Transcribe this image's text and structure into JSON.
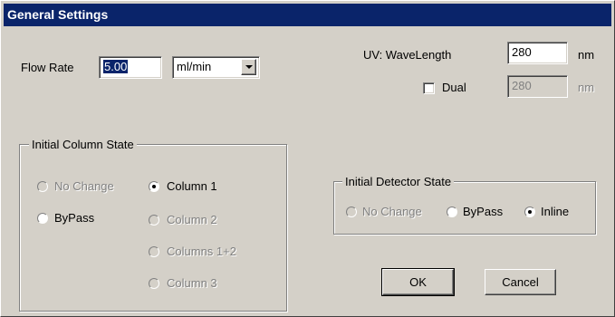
{
  "window": {
    "title": "General Settings"
  },
  "flow_rate": {
    "label": "Flow Rate",
    "value": "5.00",
    "unit_selected": "ml/min"
  },
  "uv": {
    "label": "UV: WaveLength",
    "value": "280",
    "unit": "nm",
    "dual_label": "Dual",
    "dual_checked": false,
    "dual_value": "280",
    "dual_unit": "nm"
  },
  "column_state": {
    "title": "Initial Column State",
    "options": [
      {
        "label": "No Change",
        "enabled": false,
        "selected": false
      },
      {
        "label": "Column 1",
        "enabled": true,
        "selected": true
      },
      {
        "label": "ByPass",
        "enabled": true,
        "selected": false
      },
      {
        "label": "Column 2",
        "enabled": false,
        "selected": false
      },
      {
        "label": "Columns 1+2",
        "enabled": false,
        "selected": false
      },
      {
        "label": "Column 3",
        "enabled": false,
        "selected": false
      }
    ]
  },
  "detector_state": {
    "title": "Initial Detector State",
    "options": [
      {
        "label": "No Change",
        "enabled": false,
        "selected": false
      },
      {
        "label": "ByPass",
        "enabled": true,
        "selected": false
      },
      {
        "label": "Inline",
        "enabled": true,
        "selected": true
      }
    ]
  },
  "buttons": {
    "ok": "OK",
    "cancel": "Cancel"
  }
}
